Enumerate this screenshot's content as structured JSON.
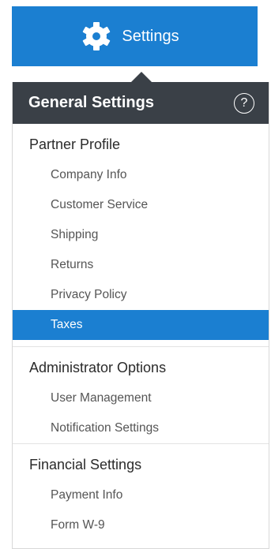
{
  "top_button": {
    "label": "Settings",
    "icon": "gear-icon",
    "color": "#1b7fd1"
  },
  "panel": {
    "title": "General Settings",
    "help_icon": "?",
    "header_color": "#3a4047",
    "selected_color": "#1b7fd1"
  },
  "sections": [
    {
      "title": "Partner Profile",
      "items": [
        "Company Info",
        "Customer Service",
        "Shipping",
        "Returns",
        "Privacy Policy",
        "Taxes"
      ]
    },
    {
      "title": "Administrator Options",
      "items": [
        "User Management",
        "Notification Settings"
      ]
    },
    {
      "title": "Financial Settings",
      "items": [
        "Payment Info",
        "Form W-9"
      ]
    }
  ],
  "selected_item": "Taxes"
}
